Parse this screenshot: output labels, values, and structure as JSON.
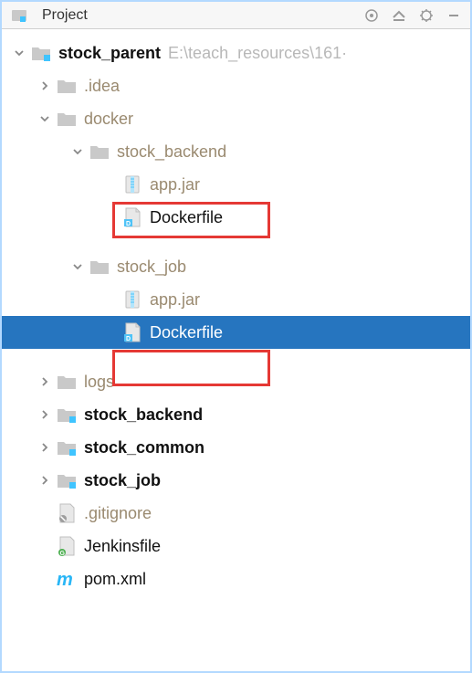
{
  "toolbar": {
    "title": "Project"
  },
  "root": {
    "name": "stock_parent",
    "path": "E:\\teach_resources\\161·"
  },
  "tree": {
    "idea": ".idea",
    "docker": "docker",
    "stock_backend_dir": "stock_backend",
    "app_jar_1": "app.jar",
    "dockerfile_1": "Dockerfile",
    "stock_job_dir": "stock_job",
    "app_jar_2": "app.jar",
    "dockerfile_2": "Dockerfile",
    "logs": "logs",
    "stock_backend_mod": "stock_backend",
    "stock_common_mod": "stock_common",
    "stock_job_mod": "stock_job",
    "gitignore": ".gitignore",
    "jenkinsfile": "Jenkinsfile",
    "pom": "pom.xml"
  },
  "colors": {
    "selection": "#2675bf",
    "highlight": "#e53935"
  }
}
